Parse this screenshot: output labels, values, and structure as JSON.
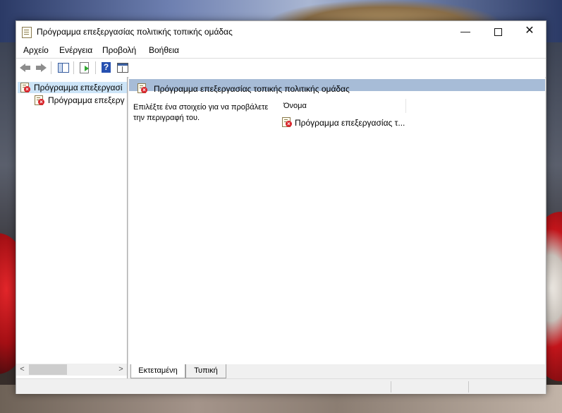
{
  "window": {
    "title": "Πρόγραμμα επεξεργασίας πολιτικής τοπικής ομάδας",
    "minimize_glyph": "—",
    "close_glyph": "✕"
  },
  "menu": {
    "items": [
      {
        "label": "Αρχείο"
      },
      {
        "label": "Ενέργεια"
      },
      {
        "label": "Προβολή"
      },
      {
        "label": "Βοήθεια"
      }
    ]
  },
  "toolbar": {
    "buttons": [
      {
        "icon": "back-arrow-icon",
        "enabled": false
      },
      {
        "icon": "forward-arrow-icon",
        "enabled": false
      },
      {
        "icon": "show-hide-console-tree-icon",
        "enabled": true
      },
      {
        "icon": "export-list-icon",
        "enabled": true
      },
      {
        "icon": "help-icon",
        "glyph": "?",
        "enabled": true
      },
      {
        "icon": "properties-icon",
        "enabled": true
      }
    ]
  },
  "tree": {
    "items": [
      {
        "label": "Πρόγραμμα επεξεργασί",
        "selected": true,
        "icon": "policy-editor-icon"
      },
      {
        "label": "Πρόγραμμα επεξεργ",
        "selected": false,
        "icon": "policy-editor-icon"
      }
    ],
    "scroll_left_glyph": "<",
    "scroll_right_glyph": ">"
  },
  "main": {
    "header_title": "Πρόγραμμα επεξεργασίας τοπικής πολιτικής ομάδας",
    "description": "Επιλέξτε ένα στοιχείο για να προβάλετε την περιγραφή του.",
    "column_header": "Όνομα",
    "list_items": [
      {
        "label": "Πρόγραμμα επεξεργασίας τ...",
        "icon": "policy-editor-icon"
      }
    ]
  },
  "tabs": [
    {
      "label": "Εκτεταμένη",
      "active": true
    },
    {
      "label": "Τυπική",
      "active": false
    }
  ],
  "colors": {
    "header_band": "#a7bcd7",
    "selection": "#cce4f7",
    "policy_x_red": "#d8232a"
  }
}
